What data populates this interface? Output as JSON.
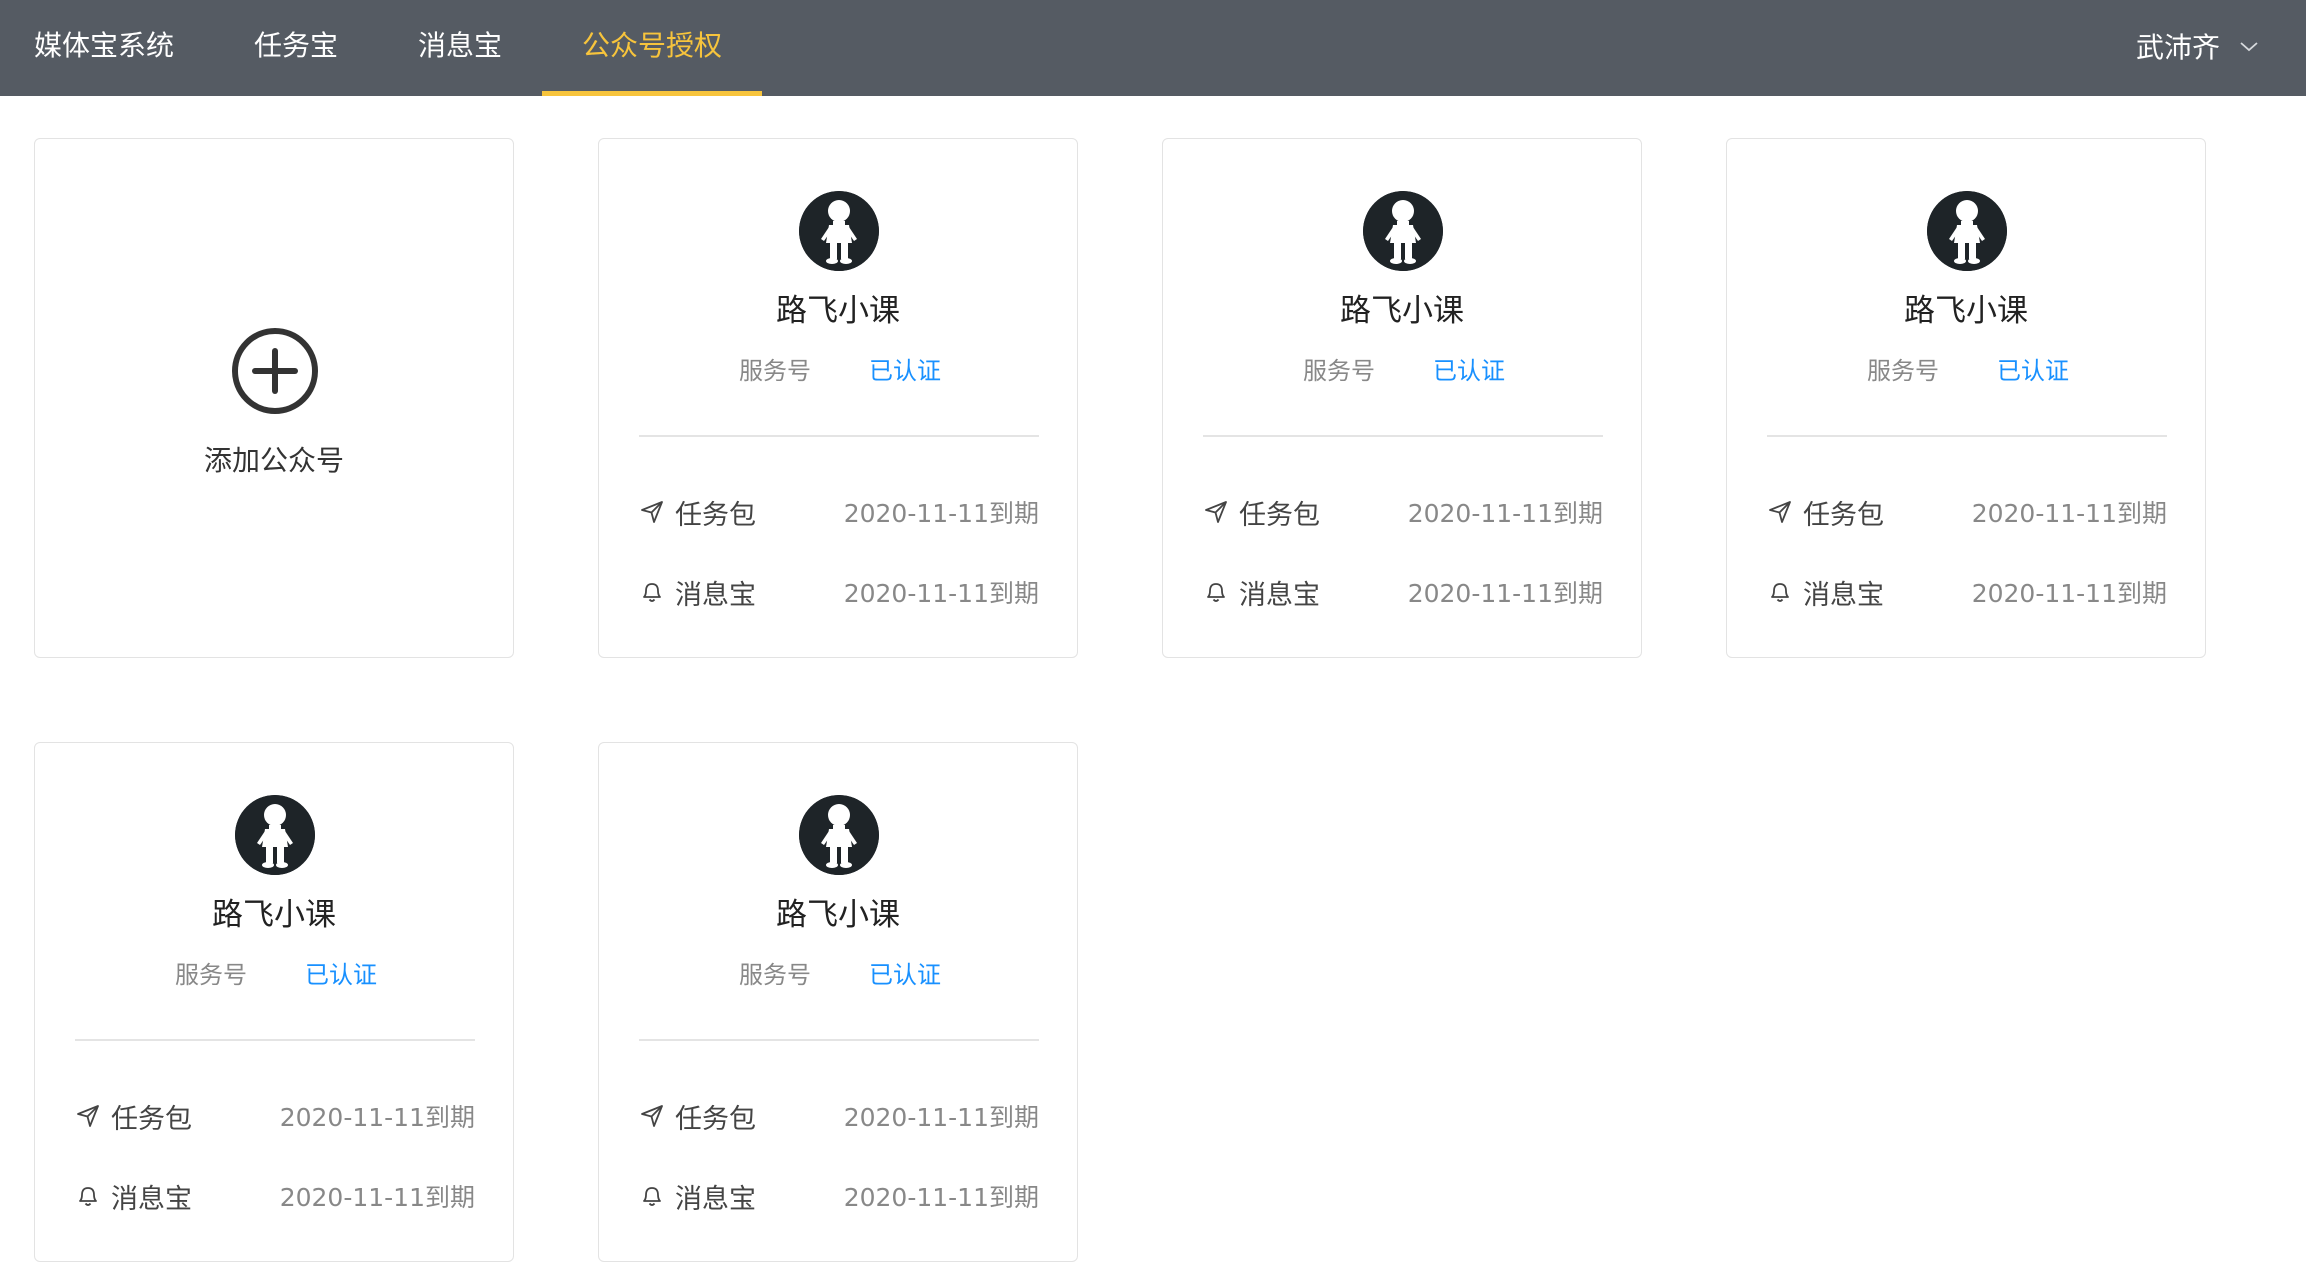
{
  "header": {
    "brand": "媒体宝系统",
    "tabs": [
      {
        "label": "任务宝"
      },
      {
        "label": "消息宝"
      },
      {
        "label": "公众号授权",
        "active": true
      }
    ],
    "user_name": "武沛齐"
  },
  "add_card": {
    "label": "添加公众号"
  },
  "accounts": [
    {
      "name": "路飞小课",
      "type": "服务号",
      "status": "已认证",
      "services": [
        {
          "icon": "send-icon",
          "label": "任务包",
          "expiry": "2020-11-11到期"
        },
        {
          "icon": "bell-icon",
          "label": "消息宝",
          "expiry": "2020-11-11到期"
        }
      ]
    },
    {
      "name": "路飞小课",
      "type": "服务号",
      "status": "已认证",
      "services": [
        {
          "icon": "send-icon",
          "label": "任务包",
          "expiry": "2020-11-11到期"
        },
        {
          "icon": "bell-icon",
          "label": "消息宝",
          "expiry": "2020-11-11到期"
        }
      ]
    },
    {
      "name": "路飞小课",
      "type": "服务号",
      "status": "已认证",
      "services": [
        {
          "icon": "send-icon",
          "label": "任务包",
          "expiry": "2020-11-11到期"
        },
        {
          "icon": "bell-icon",
          "label": "消息宝",
          "expiry": "2020-11-11到期"
        }
      ]
    },
    {
      "name": "路飞小课",
      "type": "服务号",
      "status": "已认证",
      "services": [
        {
          "icon": "send-icon",
          "label": "任务包",
          "expiry": "2020-11-11到期"
        },
        {
          "icon": "bell-icon",
          "label": "消息宝",
          "expiry": "2020-11-11到期"
        }
      ]
    },
    {
      "name": "路飞小课",
      "type": "服务号",
      "status": "已认证",
      "services": [
        {
          "icon": "send-icon",
          "label": "任务包",
          "expiry": "2020-11-11到期"
        },
        {
          "icon": "bell-icon",
          "label": "消息宝",
          "expiry": "2020-11-11到期"
        }
      ]
    }
  ],
  "colors": {
    "header_bg": "#555b63",
    "accent": "#f7c43c",
    "verified": "#1890ff"
  }
}
